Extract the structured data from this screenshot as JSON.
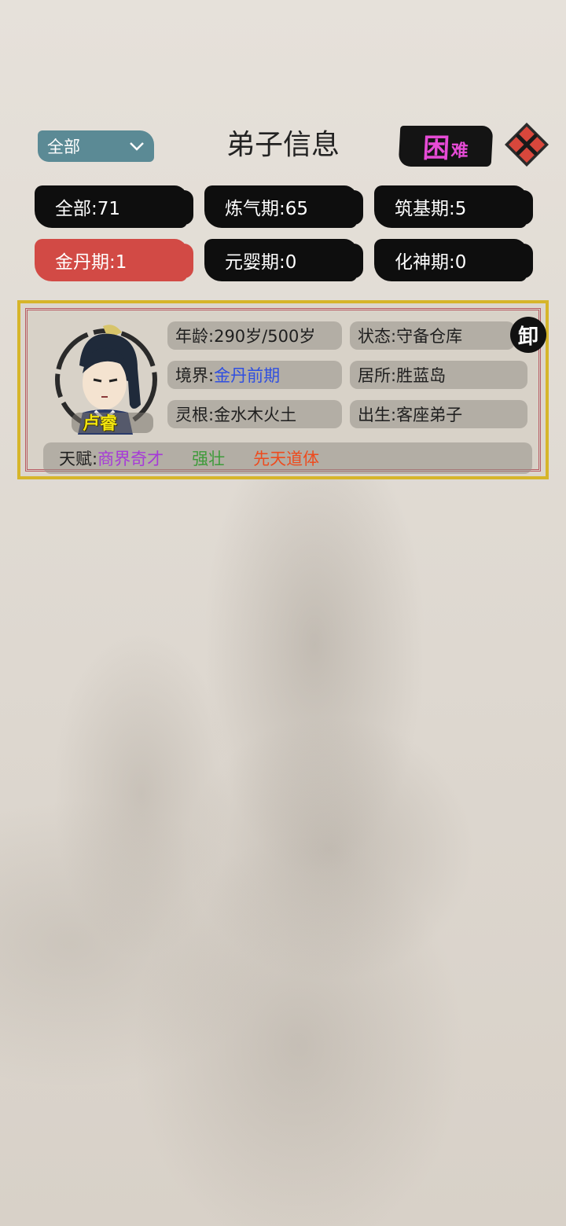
{
  "header": {
    "filter_value": "全部",
    "title": "弟子信息",
    "difficulty_main": "困",
    "difficulty_sub": "难"
  },
  "tabs": [
    {
      "label": "全部:71"
    },
    {
      "label": "炼气期:65"
    },
    {
      "label": "筑基期:5"
    },
    {
      "label": "金丹期:1"
    },
    {
      "label": "元婴期:0"
    },
    {
      "label": "化神期:0"
    }
  ],
  "disciple": {
    "name": "卢睿",
    "seal": "卸",
    "age_label": "年龄:",
    "age_value": "290岁/500岁",
    "status_label": "状态:",
    "status_value": "守备仓库",
    "realm_label": "境界:",
    "realm_value": "金丹前期",
    "residence_label": "居所:",
    "residence_value": "胜蓝岛",
    "root_label": "灵根:",
    "root_value": "金水木火土",
    "origin_label": "出生:",
    "origin_value": "客座弟子",
    "talent_label": "天赋:",
    "talents": [
      "商界奇才",
      "强壮",
      "先天道体"
    ]
  }
}
